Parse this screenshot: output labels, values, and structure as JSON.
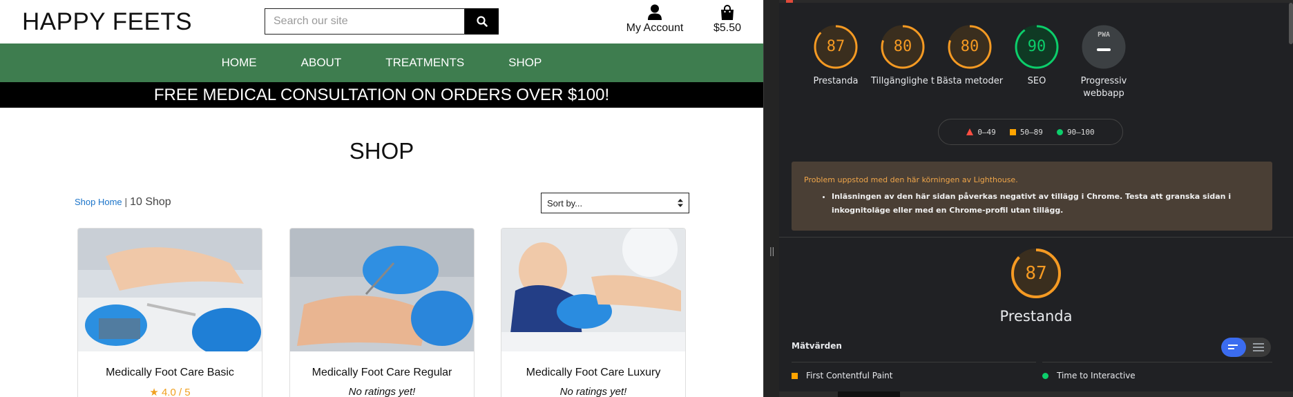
{
  "site": {
    "logo": "HAPPY FEETS",
    "search": {
      "placeholder": "Search our site"
    },
    "account_label": "My Account",
    "bag_total": "$5.50",
    "nav": [
      "HOME",
      "ABOUT",
      "TREATMENTS",
      "SHOP"
    ],
    "promo": "FREE MEDICAL CONSULTATION ON ORDERS OVER $100!",
    "page_title": "SHOP",
    "breadcrumb": {
      "home": "Shop Home",
      "sep": "|",
      "count": "10 Shop"
    },
    "sort": {
      "selected": "Sort by..."
    },
    "products": [
      {
        "title": "Medically Foot Care Basic",
        "rating": "4.0 / 5",
        "rated": true
      },
      {
        "title": "Medically Foot Care Regular",
        "rating": "No ratings yet!",
        "rated": false
      },
      {
        "title": "Medically Foot Care Luxury",
        "rating": "No ratings yet!",
        "rated": false
      }
    ]
  },
  "lighthouse": {
    "scores": [
      {
        "value": "87",
        "label": "Prestanda",
        "color": "#f59a23",
        "fraction": 0.87
      },
      {
        "value": "80",
        "label": "Tillgänglighe t",
        "color": "#f59a23",
        "fraction": 0.8
      },
      {
        "value": "80",
        "label": "Bästa metoder",
        "color": "#f59a23",
        "fraction": 0.8
      },
      {
        "value": "90",
        "label": "SEO",
        "color": "#0cce6b",
        "fraction": 0.9
      },
      {
        "value": "PWA",
        "label": "Progressiv webbapp",
        "color": "#9aa0a6",
        "fraction": 0
      }
    ],
    "legend": [
      {
        "range": "0–49",
        "color": "#ff4e42",
        "shape": "triangle"
      },
      {
        "range": "50–89",
        "color": "#ffa400",
        "shape": "square"
      },
      {
        "range": "90–100",
        "color": "#0cce6b",
        "shape": "circle"
      }
    ],
    "warning": {
      "title": "Problem uppstod med den här körningen av Lighthouse.",
      "items": [
        "Inläsningen av den här sidan påverkas negativt av tillägg i Chrome. Testa att granska sidan i inkognitoläge eller med en Chrome-profil utan tillägg."
      ]
    },
    "main_score": {
      "value": "87",
      "label": "Prestanda",
      "color": "#f59a23",
      "fraction": 0.87
    },
    "metrics_title": "Mätvärden",
    "metrics": [
      {
        "name": "First Contentful Paint",
        "color": "#ffa400"
      },
      {
        "name": "Time to Interactive",
        "color": "#0cce6b"
      }
    ]
  }
}
